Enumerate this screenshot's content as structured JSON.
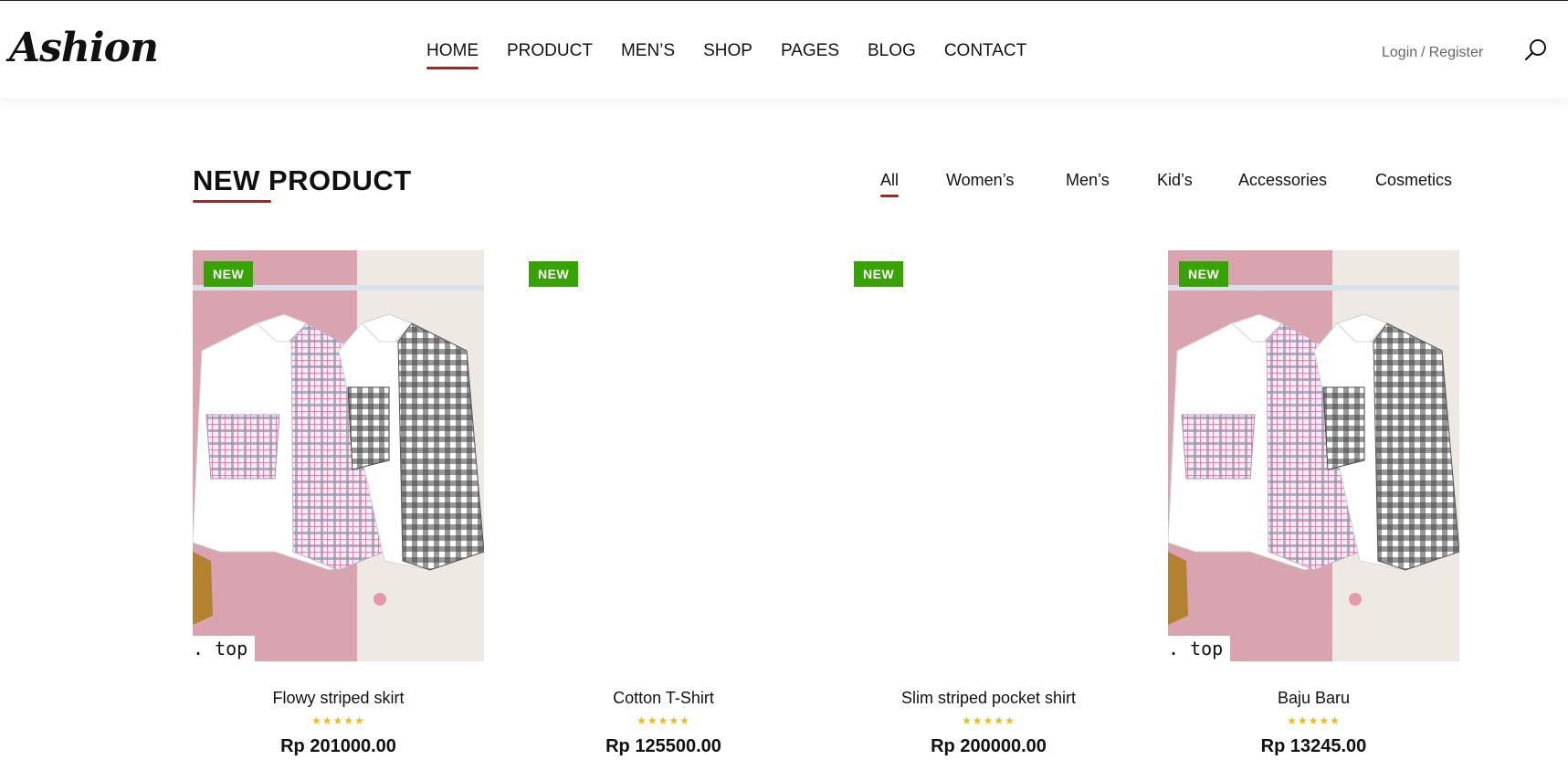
{
  "header": {
    "logo": "Ashion",
    "nav": [
      "HOME",
      "PRODUCT",
      "MEN’S",
      "SHOP",
      "PAGES",
      "BLOG",
      "CONTACT"
    ],
    "login": "Login",
    "separator": "/",
    "register": "Register",
    "search_icon": "search-icon"
  },
  "section": {
    "title": "NEW PRODUCT",
    "filters": [
      "All",
      "Women’s",
      "Men’s",
      "Kid’s",
      "Accessories",
      "Cosmetics"
    ],
    "active_filter": "All"
  },
  "products": [
    {
      "badge": "NEW",
      "name": "Flowy striped skirt",
      "rating": "★★★★★",
      "price": "Rp 201000.00",
      "image_caption": ". top",
      "has_image": true
    },
    {
      "badge": "NEW",
      "name": "Cotton T-Shirt",
      "rating": "★★★★★",
      "price": "Rp 125500.00",
      "image_caption": "",
      "has_image": false
    },
    {
      "badge": "NEW",
      "name": "Slim striped pocket shirt",
      "rating": "★★★★★",
      "price": "Rp 200000.00",
      "image_caption": "",
      "has_image": false
    },
    {
      "badge": "NEW",
      "name": "Baju Baru",
      "rating": "★★★★★",
      "price": "Rp 13245.00",
      "image_caption": ". top",
      "has_image": true
    }
  ],
  "colors": {
    "accent": "#ca1515",
    "badge": "#36a300",
    "stars": "#e3c01c"
  }
}
